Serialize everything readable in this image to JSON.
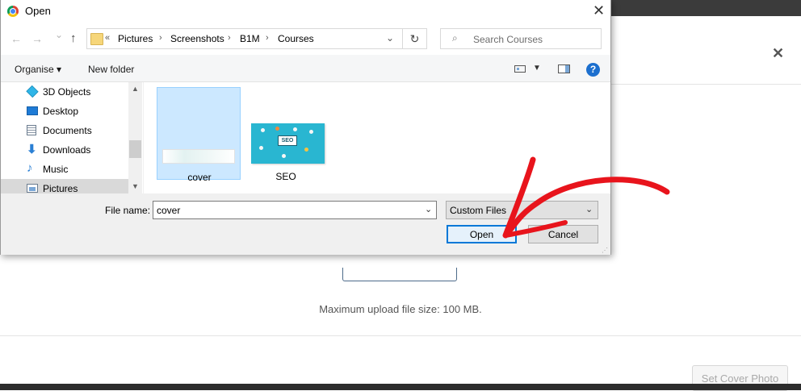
{
  "background": {
    "close_glyph": "✕",
    "max_upload_text": "Maximum upload file size: 100 MB.",
    "set_cover_label": "Set Cover Photo"
  },
  "dialog": {
    "title": "Open",
    "close_glyph": "✕",
    "back_glyph": "←",
    "forward_glyph": "→",
    "history_glyph": "⌄",
    "up_glyph": "↑",
    "overflow_glyph": "«",
    "breadcrumb": [
      "Pictures",
      "Screenshots",
      "B1M",
      "Courses"
    ],
    "crumb_sep_glyph": "›",
    "address_dropdown_glyph": "⌄",
    "refresh_glyph": "↻",
    "search_placeholder": "Search Courses",
    "search_glyph": "⌕",
    "toolbar": {
      "organise_label": "Organise ▾",
      "new_folder_label": "New folder",
      "view_dropdown_glyph": "▼",
      "help_glyph": "?"
    },
    "nav_items": [
      {
        "label": "3D Objects",
        "icon": "cube-icon",
        "color": "#2fb5e8"
      },
      {
        "label": "Desktop",
        "icon": "desktop-icon",
        "color": "#1e7bd6"
      },
      {
        "label": "Documents",
        "icon": "document-icon",
        "color": "#6b7c8f"
      },
      {
        "label": "Downloads",
        "icon": "download-arrow-icon",
        "color": "#2a7fd4"
      },
      {
        "label": "Music",
        "icon": "music-note-icon",
        "color": "#2a7fd4"
      },
      {
        "label": "Pictures",
        "icon": "pictures-icon",
        "color": "#6b7c8f"
      }
    ],
    "scroll_up_glyph": "▲",
    "scroll_down_glyph": "▼",
    "files": [
      {
        "label": "cover",
        "selected": true
      },
      {
        "label": "SEO",
        "selected": false,
        "badge": "SEO"
      }
    ],
    "file_name_label": "File name:",
    "file_name_value": "cover",
    "file_name_dropdown_glyph": "⌄",
    "filter_value": "Custom Files",
    "filter_dropdown_glyph": "⌄",
    "open_label": "Open",
    "cancel_label": "Cancel",
    "grip_glyph": "⋰"
  },
  "colors": {
    "selection_bg": "#cce8ff",
    "primary_border": "#0078d7",
    "annotation_red": "#e8141c",
    "seo_thumb": "#29b6d1"
  }
}
